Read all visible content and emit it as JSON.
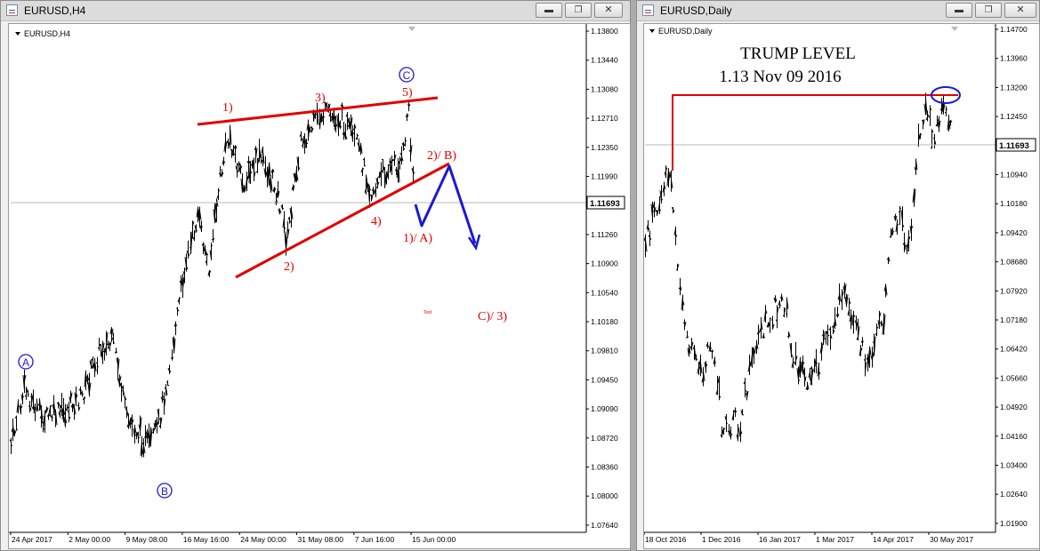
{
  "left_window": {
    "title": "EURUSD,H4",
    "chart_label": "EURUSD,H4",
    "current_price": "1.11693",
    "price_ticks": [
      "1.13800",
      "1.13440",
      "1.13080",
      "1.12710",
      "1.12350",
      "1.11990",
      "1.11630",
      "1.11260",
      "1.10900",
      "1.10540",
      "1.10180",
      "1.09810",
      "1.09450",
      "1.09090",
      "1.08720",
      "1.08360",
      "1.08000",
      "1.07640"
    ],
    "time_ticks": [
      "24 Apr 2017",
      "2 May 00:00",
      "9 May 08:00",
      "16 May 16:00",
      "24 May 00:00",
      "31 May 08:00",
      "7 Jun 16:00",
      "15 Jun 00:00"
    ],
    "wave_labels": {
      "w1": "1)",
      "w2": "2)",
      "w3": "3)",
      "w4": "4)",
      "w5": "5)",
      "wb": "2)/ B)",
      "wa": "1)/ A)",
      "wc": "C)/ 3)",
      "tiny": "Text"
    },
    "circled_labels": {
      "A": "A",
      "B": "B",
      "C": "C"
    }
  },
  "right_window": {
    "title": "EURUSD,Daily",
    "chart_label": "EURUSD,Daily",
    "current_price": "1.11693",
    "heading_line1": "TRUMP LEVEL",
    "heading_line2": "1.13  Nov 09 2016",
    "price_ticks": [
      "1.14700",
      "1.13960",
      "1.13200",
      "1.12450",
      "1.11700",
      "1.10940",
      "1.10180",
      "1.09420",
      "1.08680",
      "1.07920",
      "1.07180",
      "1.06420",
      "1.05660",
      "1.04920",
      "1.04160",
      "1.03400",
      "1.02640",
      "1.01900"
    ],
    "time_ticks": [
      "18 Oct 2016",
      "1 Dec 2016",
      "16 Jan 2017",
      "1 Mar 2017",
      "14 Apr 2017",
      "30 May 2017"
    ]
  },
  "window_buttons": {
    "minimize": "▬",
    "restore": "❐",
    "close": "✕"
  },
  "colors": {
    "wave_red": "#e00000",
    "wave_blue": "#1a1ad0",
    "bars": "#000000"
  }
}
